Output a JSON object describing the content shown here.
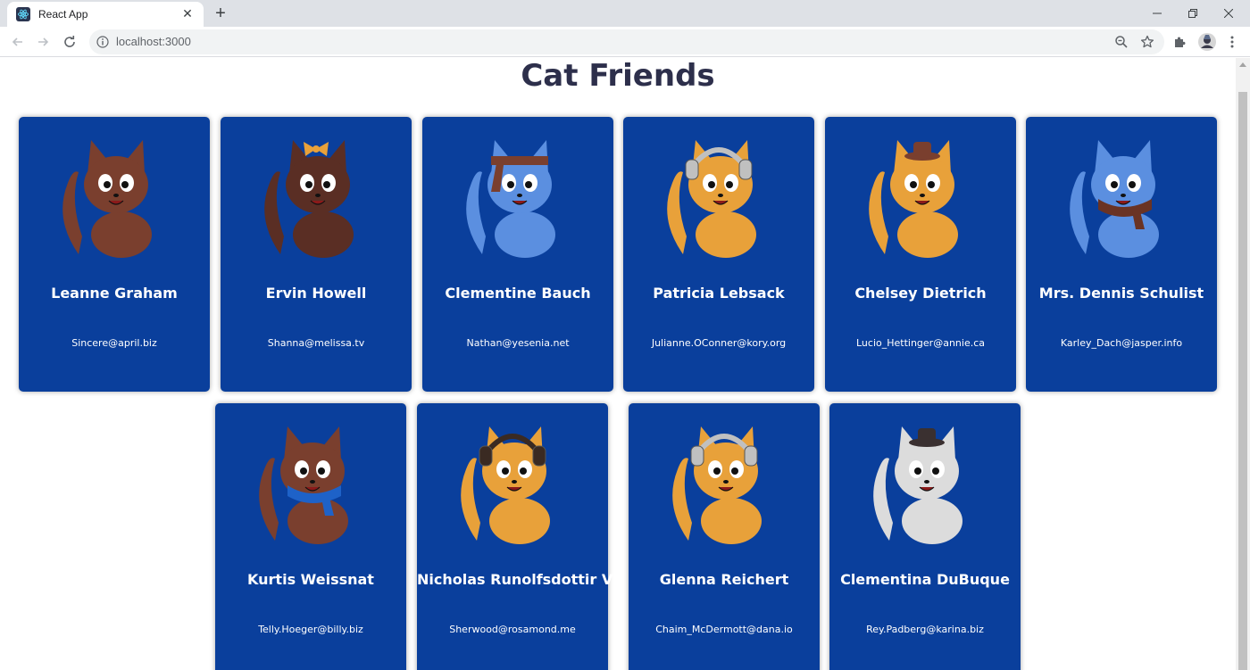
{
  "browser": {
    "tab_title": "React App",
    "tab_close": "✕",
    "new_tab": "+",
    "url": "localhost:3000",
    "window_controls": {
      "minimize": "—",
      "restore": "❐",
      "close": "✕"
    }
  },
  "page": {
    "title": "Cat Friends"
  },
  "colors": {
    "card_background": "#0a3f9c",
    "title_color": "#2d2f4b"
  },
  "robots": [
    {
      "name": "Leanne Graham",
      "email": "Sincere@april.biz",
      "cat": {
        "fur": "#7a3f2e",
        "accent": "#c9b8b0",
        "accessory": "none"
      }
    },
    {
      "name": "Ervin Howell",
      "email": "Shanna@melissa.tv",
      "cat": {
        "fur": "#5a2e24",
        "accent": "#e8a13a",
        "accessory": "bow"
      }
    },
    {
      "name": "Clementine Bauch",
      "email": "Nathan@yesenia.net",
      "cat": {
        "fur": "#5b8fe0",
        "accent": "#7a3f2e",
        "accessory": "headband"
      }
    },
    {
      "name": "Patricia Lebsack",
      "email": "Julianne.OConner@kory.org",
      "cat": {
        "fur": "#e8a13a",
        "accent": "#c0c0c0",
        "accessory": "headphones"
      }
    },
    {
      "name": "Chelsey Dietrich",
      "email": "Lucio_Hettinger@annie.ca",
      "cat": {
        "fur": "#e8a13a",
        "accent": "#7a3f2e",
        "accessory": "hat"
      }
    },
    {
      "name": "Mrs. Dennis Schulist",
      "email": "Karley_Dach@jasper.info",
      "cat": {
        "fur": "#5b8fe0",
        "accent": "#6a3324",
        "accessory": "scarf"
      }
    },
    {
      "name": "Kurtis Weissnat",
      "email": "Telly.Hoeger@billy.biz",
      "cat": {
        "fur": "#7a3f2e",
        "accent": "#1e62c8",
        "accessory": "scarf"
      }
    },
    {
      "name": "Nicholas Runolfsdottir V",
      "email": "Sherwood@rosamond.me",
      "cat": {
        "fur": "#e8a13a",
        "accent": "#3a2a22",
        "accessory": "headphones"
      }
    },
    {
      "name": "Glenna Reichert",
      "email": "Chaim_McDermott@dana.io",
      "cat": {
        "fur": "#e8a13a",
        "accent": "#c0c0c0",
        "accessory": "headphones"
      }
    },
    {
      "name": "Clementina DuBuque",
      "email": "Rey.Padberg@karina.biz",
      "cat": {
        "fur": "#dcdcdc",
        "accent": "#3a3030",
        "accessory": "hat"
      }
    }
  ]
}
